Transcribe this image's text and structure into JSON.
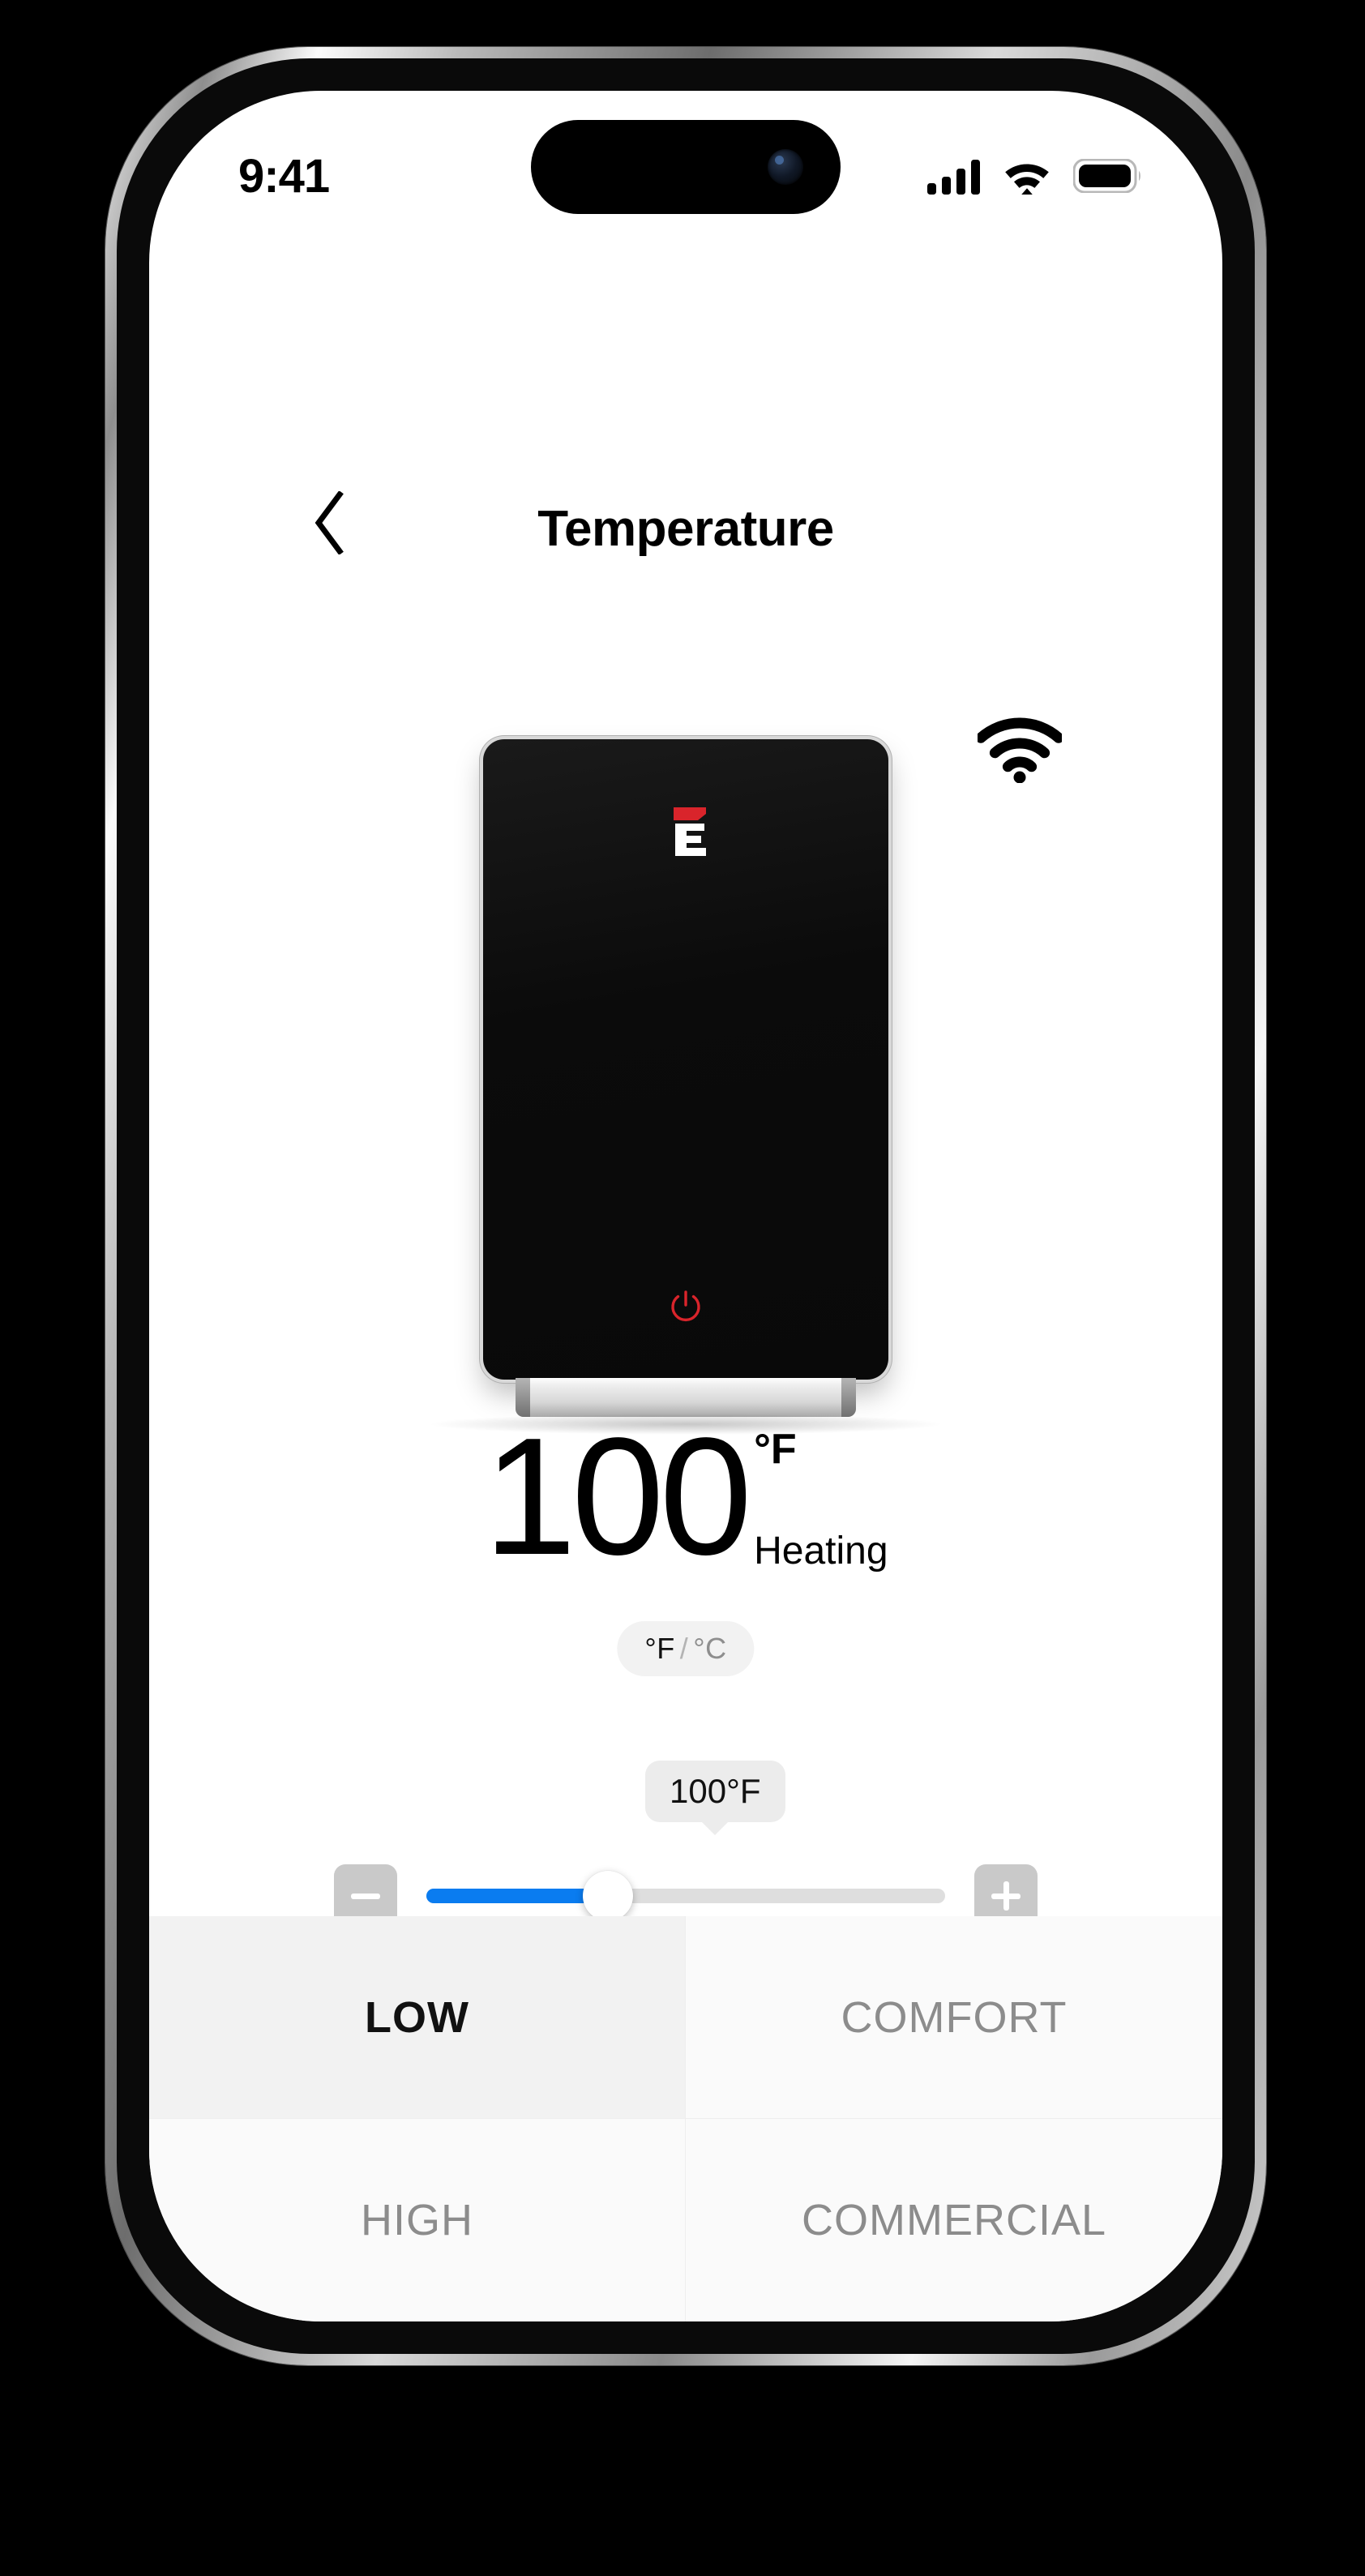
{
  "status_bar": {
    "time": "9:41",
    "cellular_icon": "cellular-bars-icon",
    "wifi_icon": "wifi-icon",
    "battery_icon": "battery-full-icon"
  },
  "header": {
    "back_icon": "chevron-left-icon",
    "title": "Temperature"
  },
  "device": {
    "logo_icon": "brand-e-logo-icon",
    "power_icon": "power-icon",
    "wifi_status_icon": "wifi-icon",
    "logo_color_top": "#d9242b",
    "logo_color_bottom": "#ffffff",
    "power_color": "#d9242b",
    "body_color": "#0b0b0b"
  },
  "temperature": {
    "value": "100",
    "unit": "°F",
    "state": "Heating",
    "toggle": {
      "active": "°F",
      "separator": "/",
      "inactive": "°C"
    }
  },
  "slider": {
    "tooltip": "100°F",
    "decrease_label": "−",
    "increase_label": "+",
    "fill_percent": 35,
    "accent_color": "#0a7cf0",
    "track_color": "#dedede",
    "button_color": "#c9c9c9"
  },
  "modes": [
    {
      "label": "LOW",
      "selected": true
    },
    {
      "label": "COMFORT",
      "selected": false
    },
    {
      "label": "HIGH",
      "selected": false
    },
    {
      "label": "COMMERCIAL",
      "selected": false
    }
  ]
}
